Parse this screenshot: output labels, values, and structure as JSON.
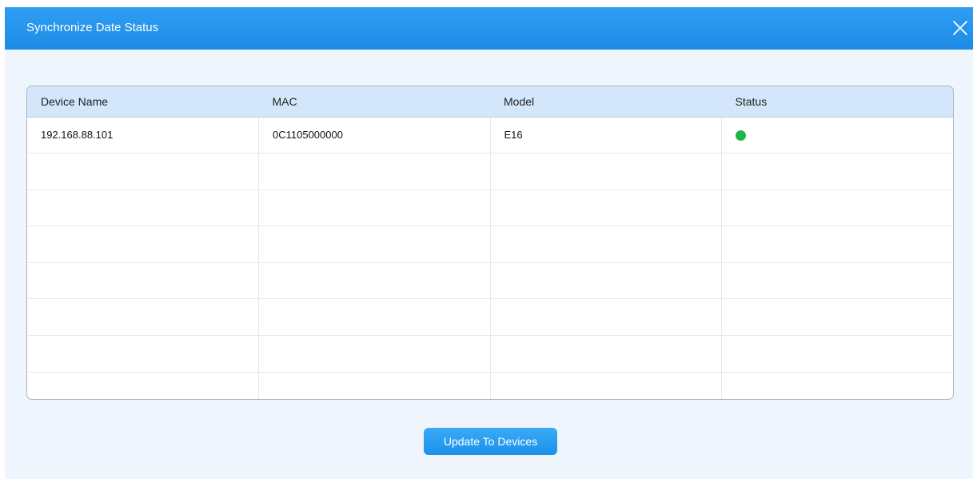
{
  "dialog": {
    "title": "Synchronize Date Status",
    "close_icon": "close-icon"
  },
  "table": {
    "columns": [
      "Device Name",
      "MAC",
      "Model",
      "Status"
    ],
    "rows": [
      {
        "device_name": "192.168.88.101",
        "mac": "0C1105000000",
        "model": "E16",
        "status": "online"
      },
      {
        "device_name": "",
        "mac": "",
        "model": "",
        "status": ""
      },
      {
        "device_name": "",
        "mac": "",
        "model": "",
        "status": ""
      },
      {
        "device_name": "",
        "mac": "",
        "model": "",
        "status": ""
      },
      {
        "device_name": "",
        "mac": "",
        "model": "",
        "status": ""
      },
      {
        "device_name": "",
        "mac": "",
        "model": "",
        "status": ""
      },
      {
        "device_name": "",
        "mac": "",
        "model": "",
        "status": ""
      },
      {
        "device_name": "",
        "mac": "",
        "model": "",
        "status": ""
      }
    ]
  },
  "footer": {
    "update_label": "Update To Devices"
  },
  "colors": {
    "titlebar": "#1d8be6",
    "status_online": "#1fb449",
    "button": "#1c91ea"
  }
}
